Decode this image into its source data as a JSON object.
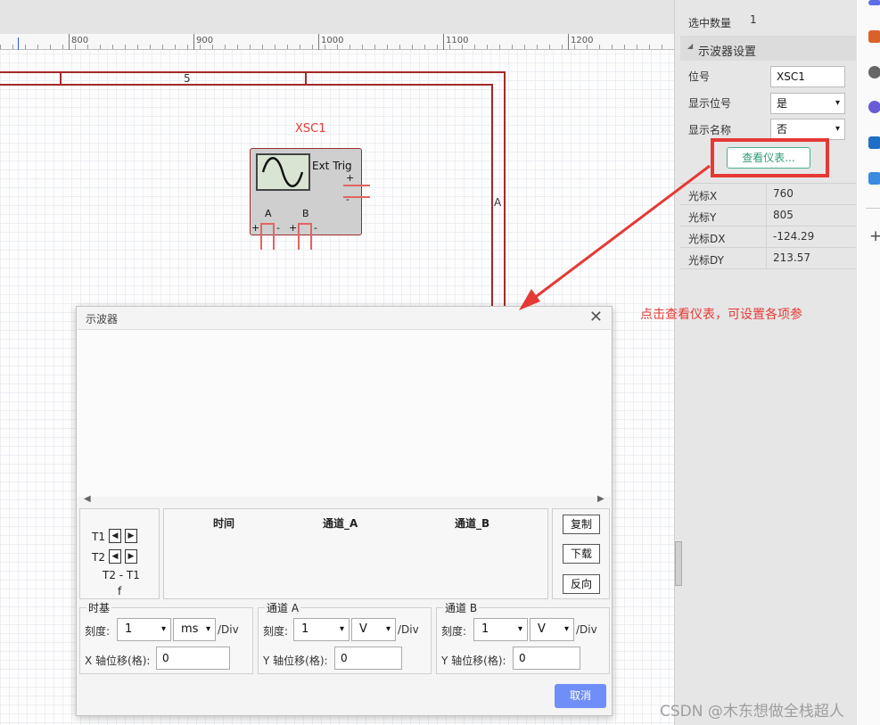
{
  "ruler": {
    "labels": [
      "800",
      "900",
      "1000",
      "1100",
      "1200"
    ]
  },
  "canvas": {
    "wire_label_5": "5",
    "wire_label_a": "A",
    "component_label": "XSC1",
    "ext_trig": "Ext Trig",
    "pin_plus": "+",
    "pin_minus": "-",
    "pin_a": "A",
    "pin_b": "B"
  },
  "side_panel": {
    "selected_count_label": "选中数量",
    "selected_count_value": "1",
    "section_title": "示波器设置",
    "designator_label": "位号",
    "designator_value": "XSC1",
    "show_designator_label": "显示位号",
    "show_designator_value": "是",
    "show_name_label": "显示名称",
    "show_name_value": "否",
    "view_instrument_button": "查看仪表...",
    "cursor_rows": [
      {
        "key": "光标X",
        "value": "760"
      },
      {
        "key": "光标Y",
        "value": "805"
      },
      {
        "key": "光标DX",
        "value": "-124.29"
      },
      {
        "key": "光标DY",
        "value": "213.57"
      }
    ]
  },
  "annotation": {
    "note": "点击查看仪表，可设置各项参",
    "watermark": "CSDN @木东想做全栈超人",
    "color": "#e53935"
  },
  "dialog": {
    "title": "示波器",
    "close_glyph": "✕",
    "t1_label": "T1",
    "t2_label": "T2",
    "t2_minus_t1": "T2 - T1",
    "f_label": "f",
    "col_time": "时间",
    "col_channel_a": "通道_A",
    "col_channel_b": "通道_B",
    "copy_button": "复制",
    "download_button": "下载",
    "reverse_button": "反向",
    "timebase": {
      "title": "时基",
      "scale_label": "刻度:",
      "scale_value": "1",
      "unit_value": "ms",
      "per_div": "/Div",
      "offset_label": "X 轴位移(格):",
      "offset_value": "0"
    },
    "channel_a": {
      "title": "通道 A",
      "scale_label": "刻度:",
      "scale_value": "1",
      "unit_value": "V",
      "per_div": "/Div",
      "offset_label": "Y 轴位移(格):",
      "offset_value": "0"
    },
    "channel_b": {
      "title": "通道 B",
      "scale_label": "刻度:",
      "scale_value": "1",
      "unit_value": "V",
      "per_div": "/Div",
      "offset_label": "Y 轴位移(格):",
      "offset_value": "0"
    },
    "cancel_button": "取消",
    "accent_color": "#6f8ef7"
  },
  "icons": {
    "dropdown": "▾",
    "left_arrow": "◀",
    "right_arrow": "▶",
    "plus": "+"
  }
}
